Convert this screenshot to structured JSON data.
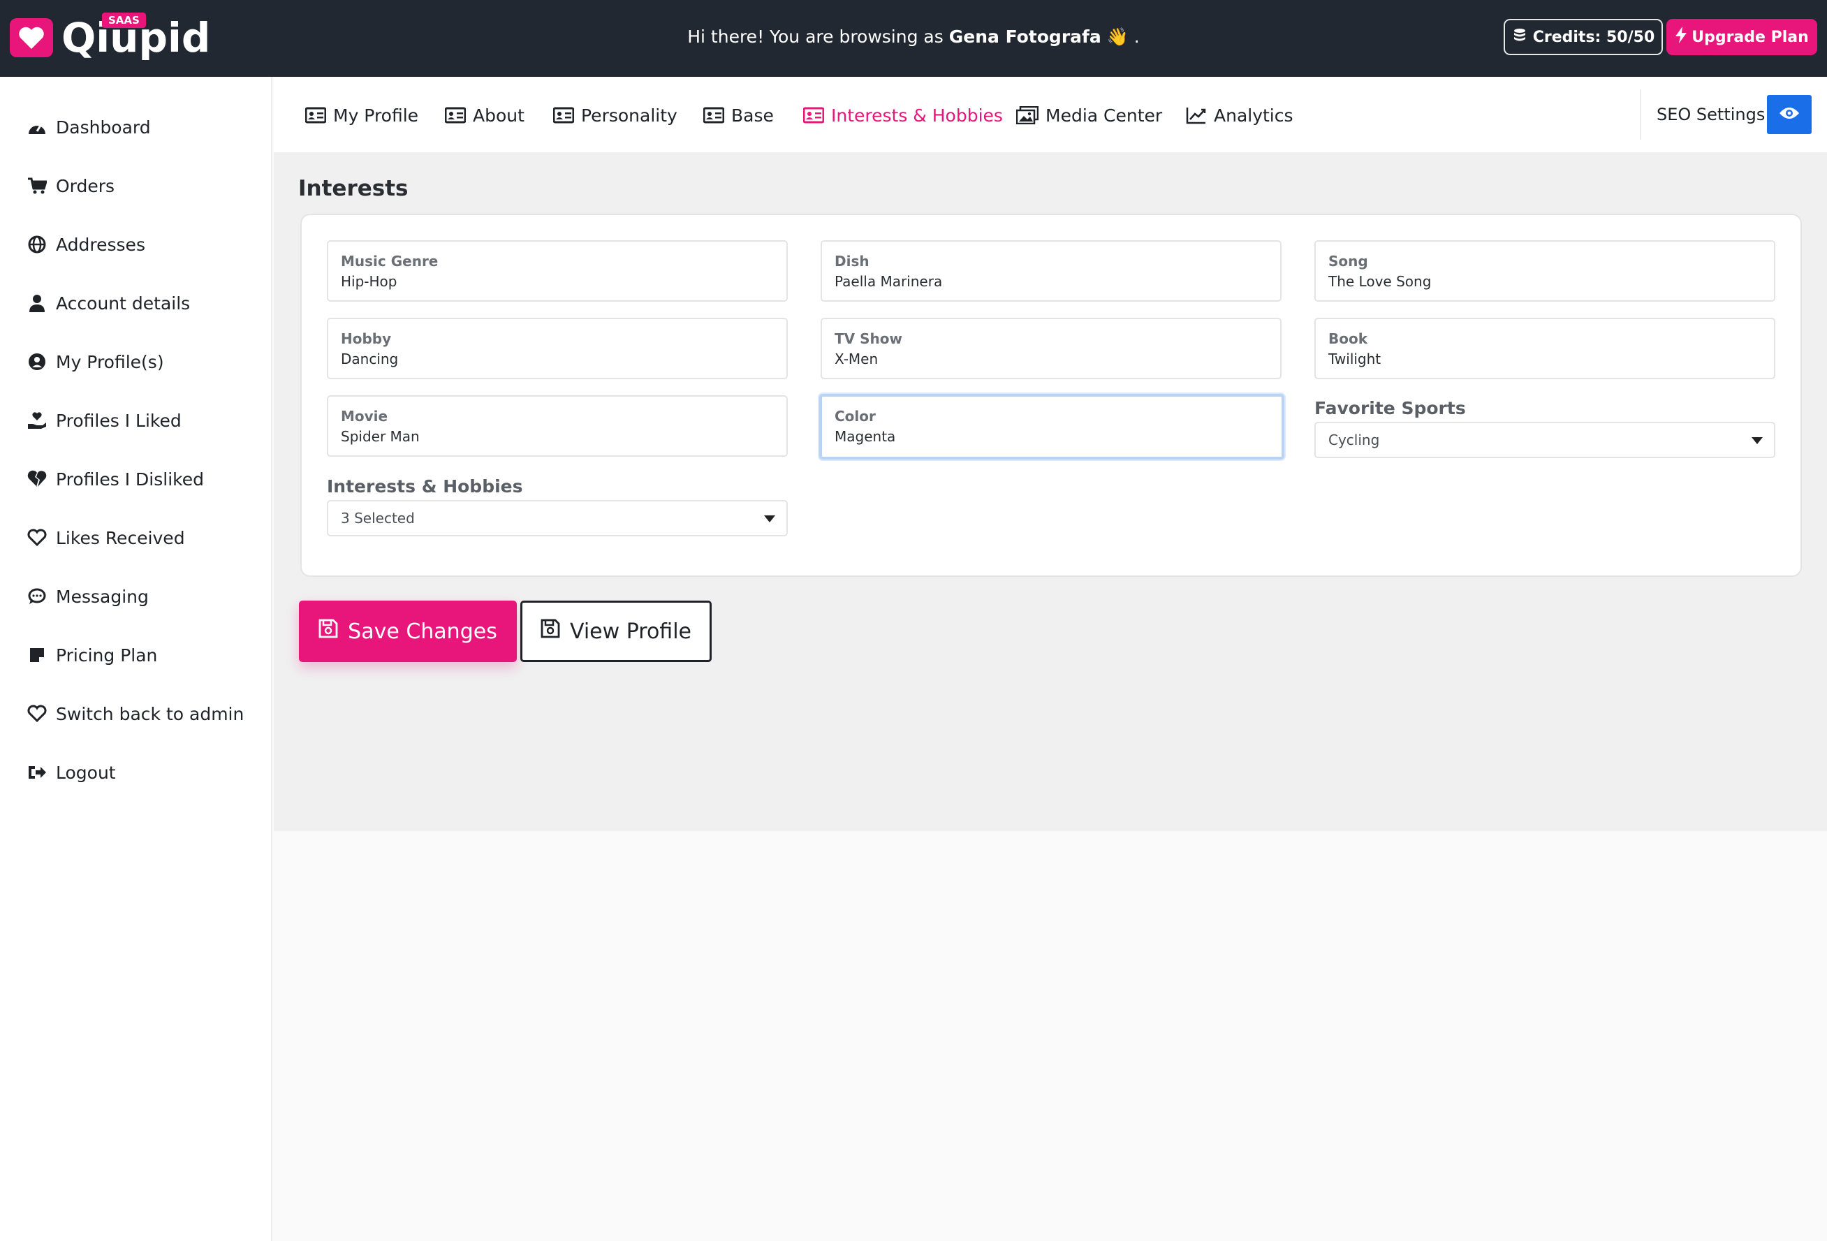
{
  "header": {
    "brand": "Qiupid",
    "badge": "SAAS",
    "greeting_prefix": "Hi there! You are browsing as",
    "greeting_name": "Gena Fotografa",
    "greeting_suffix": "👋 .",
    "credits_label": "Credits: 50/50",
    "upgrade_label": "Upgrade Plan",
    "brand_color": "#e8157a",
    "bar_color": "#222831"
  },
  "sidebar": {
    "items": [
      {
        "label": "Dashboard",
        "icon": "dashboard-gauge-icon"
      },
      {
        "label": "Orders",
        "icon": "shopping-cart-icon"
      },
      {
        "label": "Addresses",
        "icon": "globe-icon"
      },
      {
        "label": "Account details",
        "icon": "user-icon"
      },
      {
        "label": "My Profile(s)",
        "icon": "user-circle-icon"
      },
      {
        "label": "Profiles I Liked",
        "icon": "hand-heart-icon"
      },
      {
        "label": "Profiles I Disliked",
        "icon": "broken-heart-icon"
      },
      {
        "label": "Likes Received",
        "icon": "heart-outline-icon"
      },
      {
        "label": "Messaging",
        "icon": "chat-bubble-icon"
      },
      {
        "label": "Pricing Plan",
        "icon": "note-icon"
      },
      {
        "label": "Switch back to admin",
        "icon": "heart-outline-icon"
      },
      {
        "label": "Logout",
        "icon": "logout-icon"
      }
    ]
  },
  "tabs": [
    {
      "label": "My Profile",
      "icon": "id-card-icon"
    },
    {
      "label": "About",
      "icon": "id-card-icon"
    },
    {
      "label": "Personality",
      "icon": "id-card-icon"
    },
    {
      "label": "Base",
      "icon": "id-card-icon"
    },
    {
      "label": "Interests & Hobbies",
      "icon": "id-card-icon",
      "active": true
    },
    {
      "label": "Media Center",
      "icon": "photo-album-icon"
    },
    {
      "label": "Analytics",
      "icon": "chart-line-icon"
    }
  ],
  "seo": {
    "label": "SEO Settings"
  },
  "section": {
    "title": "Interests"
  },
  "fields": [
    {
      "label": "Music Genre",
      "value": "Hip-Hop"
    },
    {
      "label": "Dish",
      "value": "Paella Marinera"
    },
    {
      "label": "Song",
      "value": "The Love Song"
    },
    {
      "label": "Hobby",
      "value": "Dancing"
    },
    {
      "label": "TV Show",
      "value": "X-Men"
    },
    {
      "label": "Book",
      "value": "Twilight"
    },
    {
      "label": "Movie",
      "value": "Spider Man"
    },
    {
      "label": "Color",
      "value": "Magenta"
    }
  ],
  "selects": {
    "sports": {
      "label": "Favorite Sports",
      "value": "Cycling"
    },
    "interests": {
      "label": "Interests & Hobbies",
      "value": "3 Selected"
    }
  },
  "actions": {
    "save_label": "Save Changes",
    "view_label": "View Profile"
  }
}
